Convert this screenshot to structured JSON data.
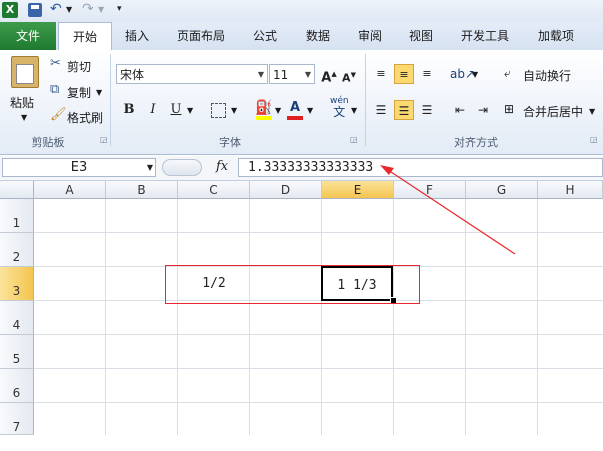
{
  "quick_access": {
    "save_icon": "save-icon",
    "undo_icon": "undo-icon",
    "redo_icon": "redo-icon"
  },
  "tabs": [
    {
      "label": "文件"
    },
    {
      "label": "开始"
    },
    {
      "label": "插入"
    },
    {
      "label": "页面布局"
    },
    {
      "label": "公式"
    },
    {
      "label": "数据"
    },
    {
      "label": "审阅"
    },
    {
      "label": "视图"
    },
    {
      "label": "开发工具"
    },
    {
      "label": "加载项"
    }
  ],
  "clipboard": {
    "paste": "粘贴",
    "cut": "剪切",
    "copy": "复制",
    "format_painter": "格式刷",
    "group": "剪贴板"
  },
  "font": {
    "name": "宋体",
    "size": "11",
    "bold": "B",
    "italic": "I",
    "underline": "U",
    "wen": "wén",
    "wen_char": "文",
    "group": "字体",
    "font_color": "#e02020",
    "fill_color": "#ffff00"
  },
  "alignment": {
    "wrap": "自动换行",
    "merge": "合并后居中",
    "group": "对齐方式"
  },
  "formula_bar": {
    "name_box": "E3",
    "fx": "fx",
    "value": "1.33333333333333"
  },
  "columns": [
    "A",
    "B",
    "C",
    "D",
    "E",
    "F",
    "G",
    "H"
  ],
  "rows": [
    "1",
    "2",
    "3",
    "4",
    "5",
    "6",
    "7"
  ],
  "cells": {
    "c3": "1/2",
    "e3": "1 1/3"
  },
  "colors": {
    "highlight_box": "#e8282f",
    "arrow": "#e8282f",
    "file_tab": "#2c8a3c"
  }
}
